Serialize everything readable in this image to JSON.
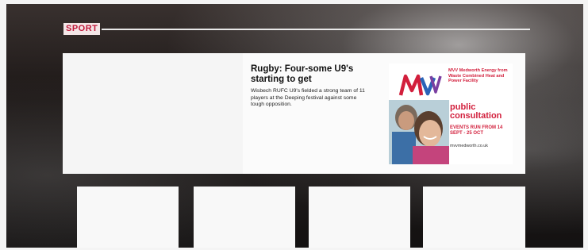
{
  "section": {
    "label": "SPORT"
  },
  "article": {
    "headline": "Rugby: Four-some U9's starting to get",
    "summary": "Wisbech RUFC U9's fielded a strong team of 11 players at the Deeping festival against some tough opposition."
  },
  "advert": {
    "logo_text": "MVV",
    "description": "MVV Medworth Energy from Waste Combined Heat and Power Facility",
    "headline": "public consultation",
    "dates": "EVENTS RUN FROM 14 SEPT - 25 OCT",
    "url": "mvvmedworth.co.uk",
    "colors": {
      "brand_red": "#d21f3c",
      "brand_blue": "#2a63b8"
    }
  }
}
